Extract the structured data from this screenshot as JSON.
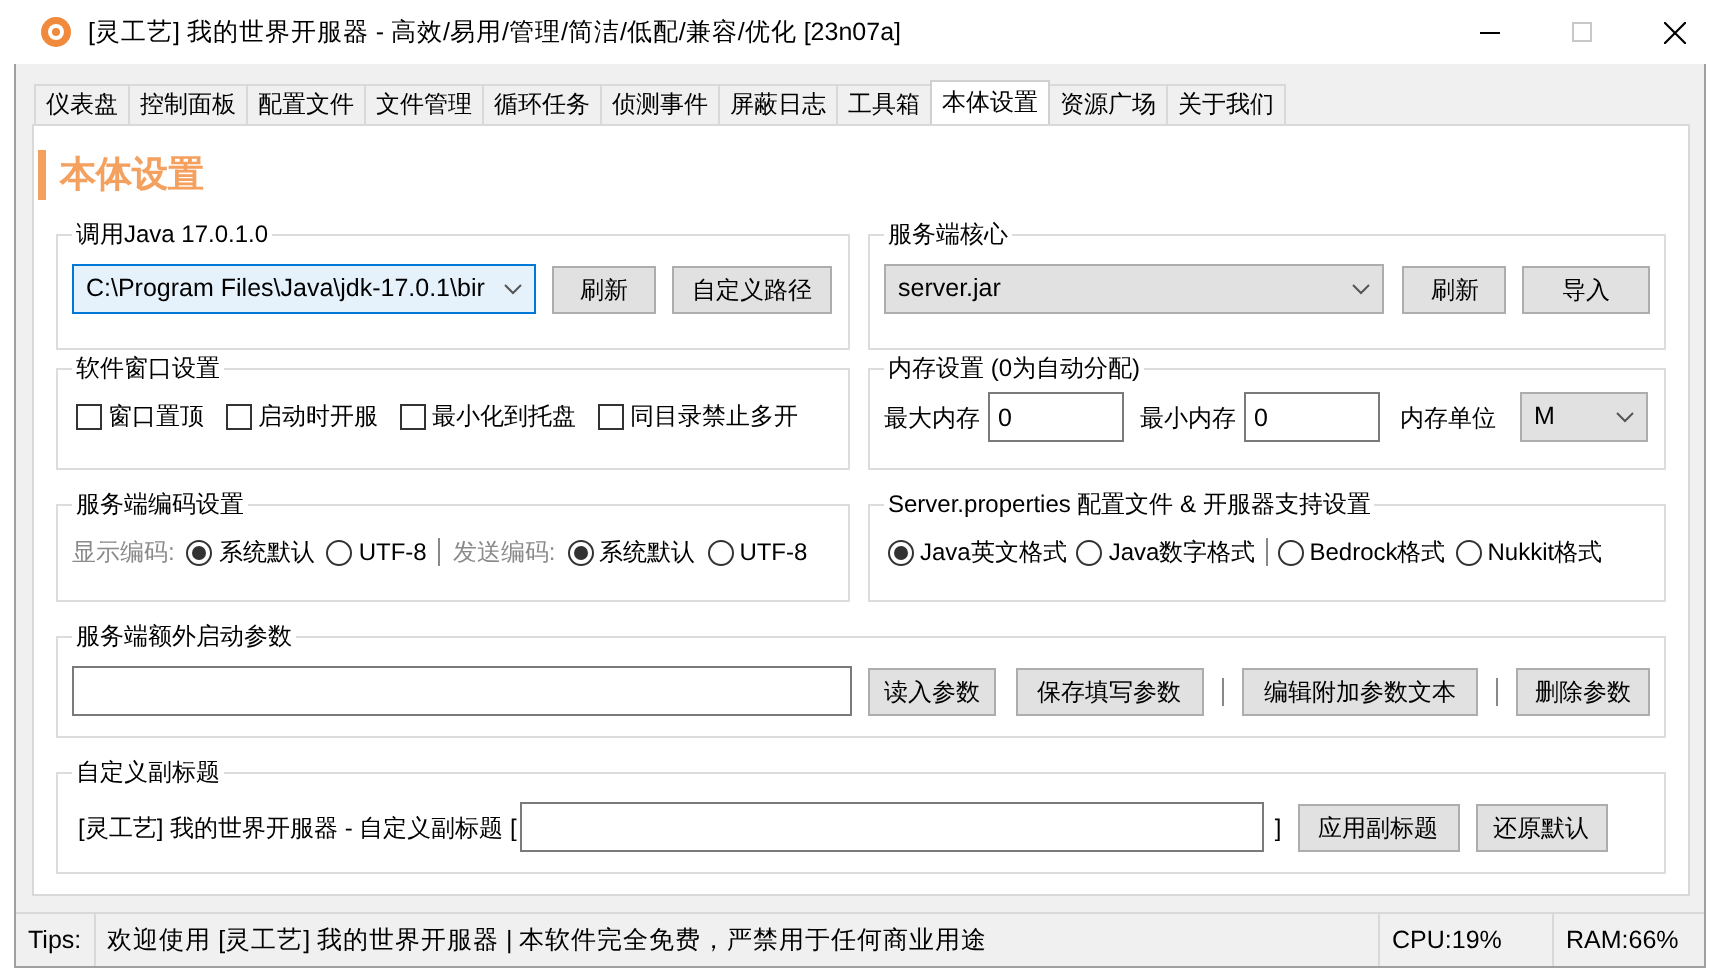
{
  "window": {
    "title": "[灵工艺] 我的世界开服器 - 高效/易用/管理/简洁/低配/兼容/优化 [23n07a]"
  },
  "tabs": [
    {
      "label": "仪表盘",
      "selected": false
    },
    {
      "label": "控制面板",
      "selected": false
    },
    {
      "label": "配置文件",
      "selected": false
    },
    {
      "label": "文件管理",
      "selected": false
    },
    {
      "label": "循环任务",
      "selected": false
    },
    {
      "label": "侦测事件",
      "selected": false
    },
    {
      "label": "屏蔽日志",
      "selected": false
    },
    {
      "label": "工具箱",
      "selected": false
    },
    {
      "label": "本体设置",
      "selected": true
    },
    {
      "label": "资源广场",
      "selected": false
    },
    {
      "label": "关于我们",
      "selected": false
    }
  ],
  "page_title": "本体设置",
  "java": {
    "legend": "调用Java 17.0.1.0",
    "path": "C:\\Program Files\\Java\\jdk-17.0.1\\bir",
    "focused": true,
    "buttons": [
      "刷新",
      "自定义路径"
    ]
  },
  "core": {
    "legend": "服务端核心",
    "value": "server.jar",
    "buttons": [
      "刷新",
      "导入"
    ]
  },
  "window_settings": {
    "legend": "软件窗口设置",
    "options": [
      {
        "label": "窗口置顶",
        "checked": false
      },
      {
        "label": "启动时开服",
        "checked": false
      },
      {
        "label": "最小化到托盘",
        "checked": false
      },
      {
        "label": "同目录禁止多开",
        "checked": false
      }
    ]
  },
  "memory": {
    "legend": "内存设置 (0为自动分配)",
    "fields": [
      {
        "label": "最大内存",
        "value": "0"
      },
      {
        "label": "最小内存",
        "value": "0"
      }
    ],
    "unit_label": "内存单位",
    "unit": "M"
  },
  "encoding": {
    "legend": "服务端编码设置",
    "groups": [
      {
        "label": "显示编码:",
        "options": [
          {
            "label": "系统默认",
            "selected": true
          },
          {
            "label": "UTF-8",
            "selected": false
          }
        ]
      },
      {
        "label": "发送编码:",
        "options": [
          {
            "label": "系统默认",
            "selected": true
          },
          {
            "label": "UTF-8",
            "selected": false
          }
        ]
      }
    ]
  },
  "properties": {
    "legend": "Server.properties 配置文件 & 开服器支持设置",
    "groups": [
      {
        "options": [
          {
            "label": "Java英文格式",
            "selected": true
          },
          {
            "label": "Java数字格式",
            "selected": false
          }
        ]
      },
      {
        "options": [
          {
            "label": "Bedrock格式",
            "selected": false
          },
          {
            "label": "Nukkit格式",
            "selected": false
          }
        ]
      }
    ]
  },
  "extra_args": {
    "legend": "服务端额外启动参数",
    "button_groups": [
      [
        "读入参数",
        "保存填写参数"
      ],
      [
        "编辑附加参数文本"
      ],
      [
        "删除参数"
      ]
    ]
  },
  "subtitle": {
    "legend": "自定义副标题",
    "prefix": "[灵工艺] 我的世界开服器 - 自定义副标题 [",
    "suffix": "]",
    "buttons": [
      "应用副标题",
      "还原默认"
    ]
  },
  "status_bar": {
    "tips_label": "Tips:",
    "message": "欢迎使用 [灵工艺] 我的世界开服器 | 本软件完全免费，严禁用于任何商业用途",
    "cpu": "CPU:19%",
    "ram": "RAM:66%"
  }
}
